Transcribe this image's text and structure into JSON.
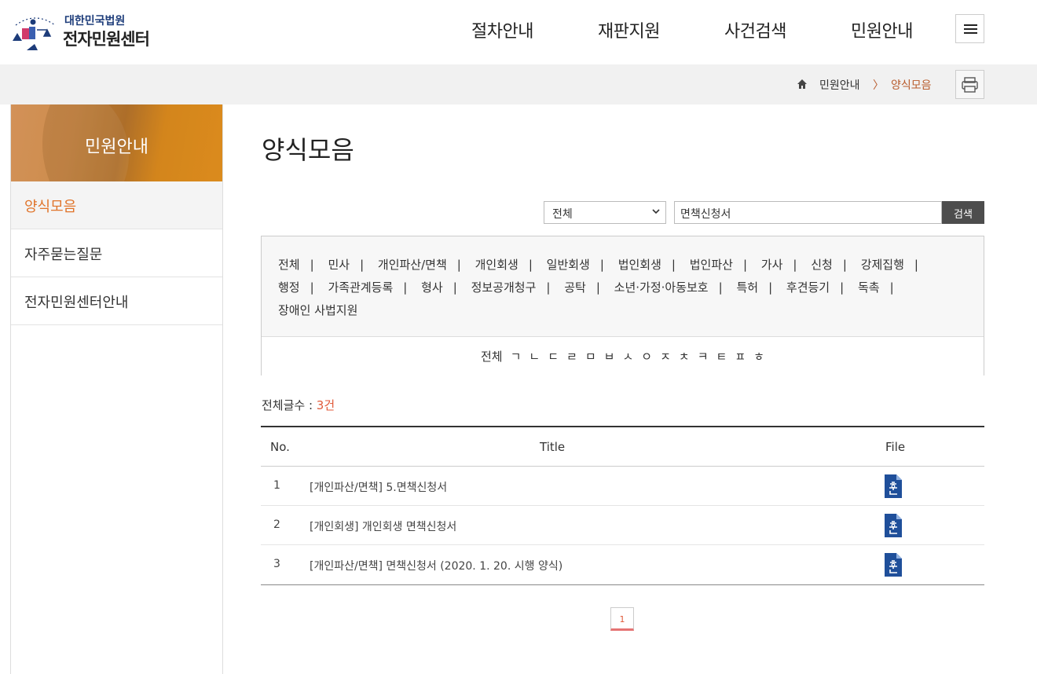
{
  "header": {
    "logo_top": "대한민국법원",
    "logo_main": "전자민원센터",
    "nav": [
      "절차안내",
      "재판지원",
      "사건검색",
      "민원안내"
    ]
  },
  "breadcrumb": {
    "items": [
      "민원안내",
      "양식모음"
    ],
    "separator": "〉"
  },
  "sidebar": {
    "title": "민원안내",
    "items": [
      "양식모음",
      "자주묻는질문",
      "전자민원센터안내"
    ]
  },
  "main": {
    "title": "양식모음",
    "search": {
      "select_value": "전체",
      "input_value": "면책신청서",
      "button_label": "검색"
    },
    "categories": [
      "전체",
      "민사",
      "개인파산/면책",
      "개인회생",
      "일반회생",
      "법인회생",
      "법인파산",
      "가사",
      "신청",
      "강제집행",
      "행정",
      "가족관계등록",
      "형사",
      "정보공개청구",
      "공탁",
      "소년·가정·아동보호",
      "특허",
      "후견등기",
      "독촉",
      "장애인 사법지원"
    ],
    "consonants": [
      "전체",
      "ㄱ",
      "ㄴ",
      "ㄷ",
      "ㄹ",
      "ㅁ",
      "ㅂ",
      "ㅅ",
      "ㅇ",
      "ㅈ",
      "ㅊ",
      "ㅋ",
      "ㅌ",
      "ㅍ",
      "ㅎ"
    ],
    "total_label": "전체글수 : ",
    "total_count": "3건",
    "table": {
      "headers": [
        "No.",
        "Title",
        "File"
      ],
      "rows": [
        {
          "no": "1",
          "title": "[개인파산/면책] 5.면책신청서",
          "file_icon": "hwp-file-icon"
        },
        {
          "no": "2",
          "title": "[개인회생] 개인회생 면책신청서",
          "file_icon": "hwp-file-icon"
        },
        {
          "no": "3",
          "title": "[개인파산/면책] 면책신청서 (2020. 1. 20. 시행 양식)",
          "file_icon": "hwp-file-icon"
        }
      ]
    },
    "pagination": {
      "current": "1"
    }
  },
  "colors": {
    "accent": "#e0742a",
    "breadcrumb_active": "#b85a2a",
    "count": "#e05a3a",
    "file_icon": "#1f4f9a",
    "search_button": "#4d4d4d"
  }
}
